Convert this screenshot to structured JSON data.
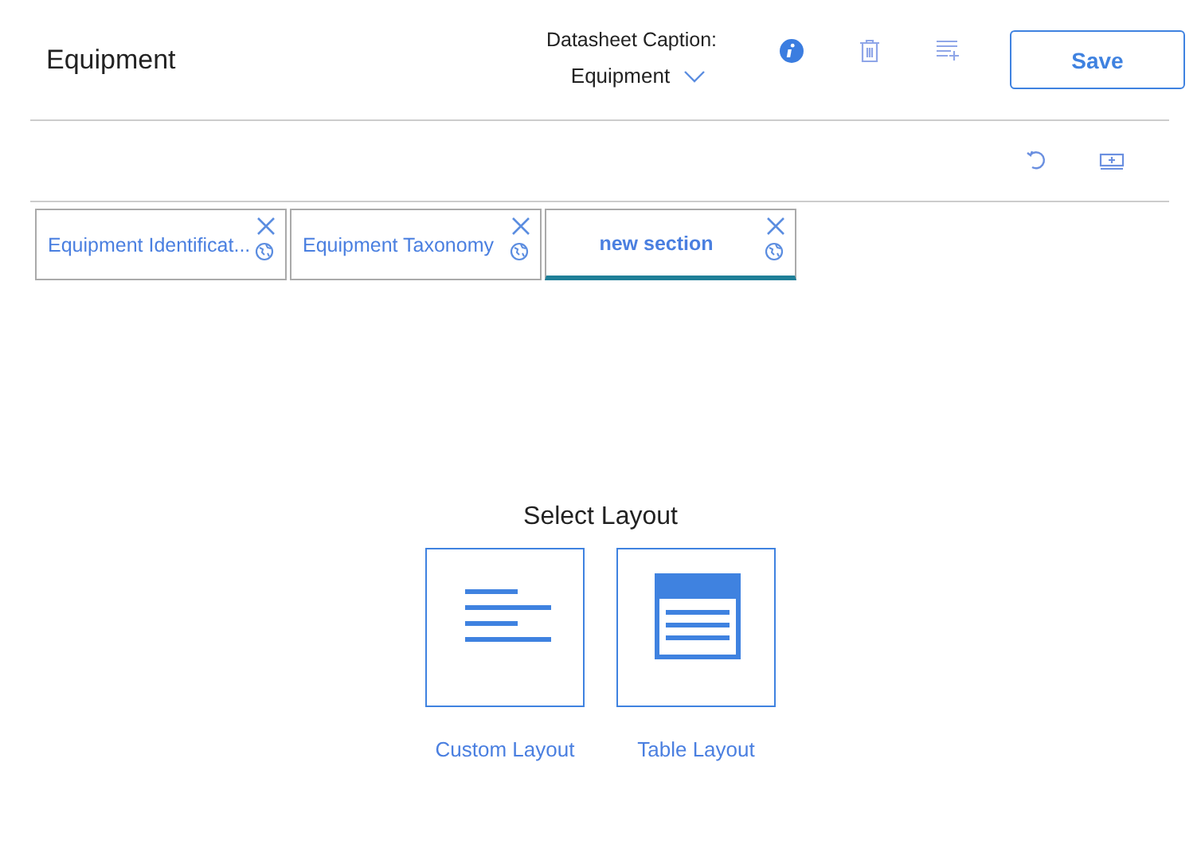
{
  "header": {
    "title": "Equipment",
    "caption_label": "Datasheet Caption:",
    "caption_value": "Equipment",
    "save": "Save"
  },
  "tabs": [
    {
      "label": "Equipment Identificat...",
      "selected": false
    },
    {
      "label": "Equipment Taxonomy",
      "selected": false
    },
    {
      "label": "new section",
      "selected": true
    }
  ],
  "layout_picker": {
    "title": "Select Layout",
    "options": [
      {
        "kind": "custom",
        "label": "Custom Layout"
      },
      {
        "kind": "table",
        "label": "Table Layout"
      }
    ]
  }
}
